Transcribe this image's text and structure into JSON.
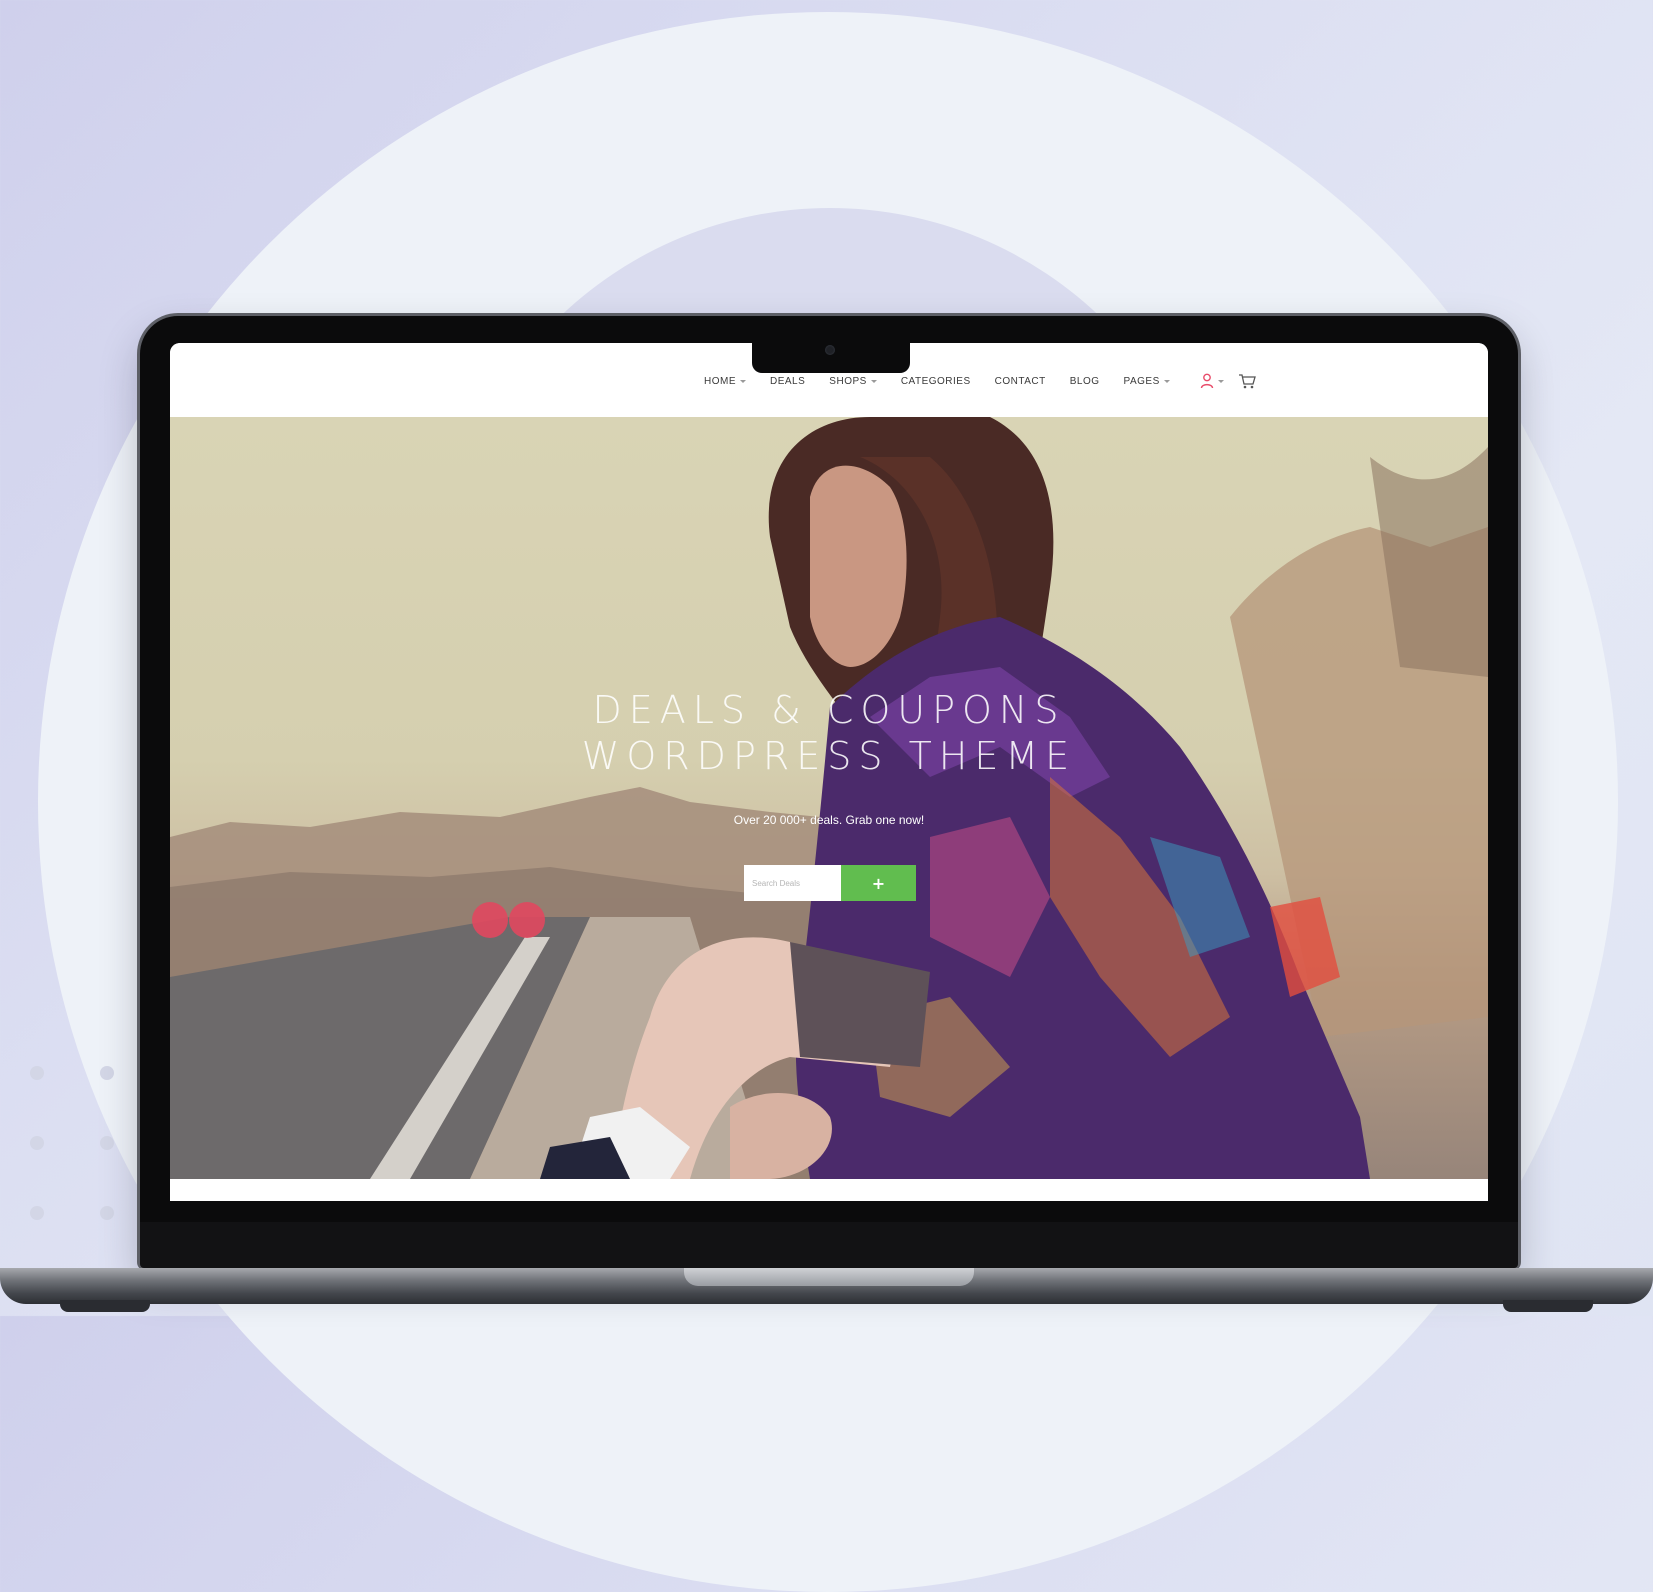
{
  "site": {
    "nav": {
      "items": [
        {
          "label": "HOME",
          "dropdown": true
        },
        {
          "label": "DEALS",
          "dropdown": false
        },
        {
          "label": "SHOPS",
          "dropdown": true
        },
        {
          "label": "CATEGORIES",
          "dropdown": false
        },
        {
          "label": "CONTACT",
          "dropdown": false
        },
        {
          "label": "BLOG",
          "dropdown": false
        },
        {
          "label": "PAGES",
          "dropdown": true
        }
      ],
      "icons": {
        "account": "user-icon",
        "cart": "cart-icon"
      },
      "accent_color": "#e84c6a"
    },
    "hero": {
      "title_line1": "DEALS & COUPONS",
      "title_line2": "WORDPRESS THEME",
      "subtitle": "Over 20 000+ deals. Grab one now!",
      "search": {
        "placeholder": "Search Deals",
        "button_icon": "+",
        "button_color": "#61bd4f"
      }
    }
  }
}
